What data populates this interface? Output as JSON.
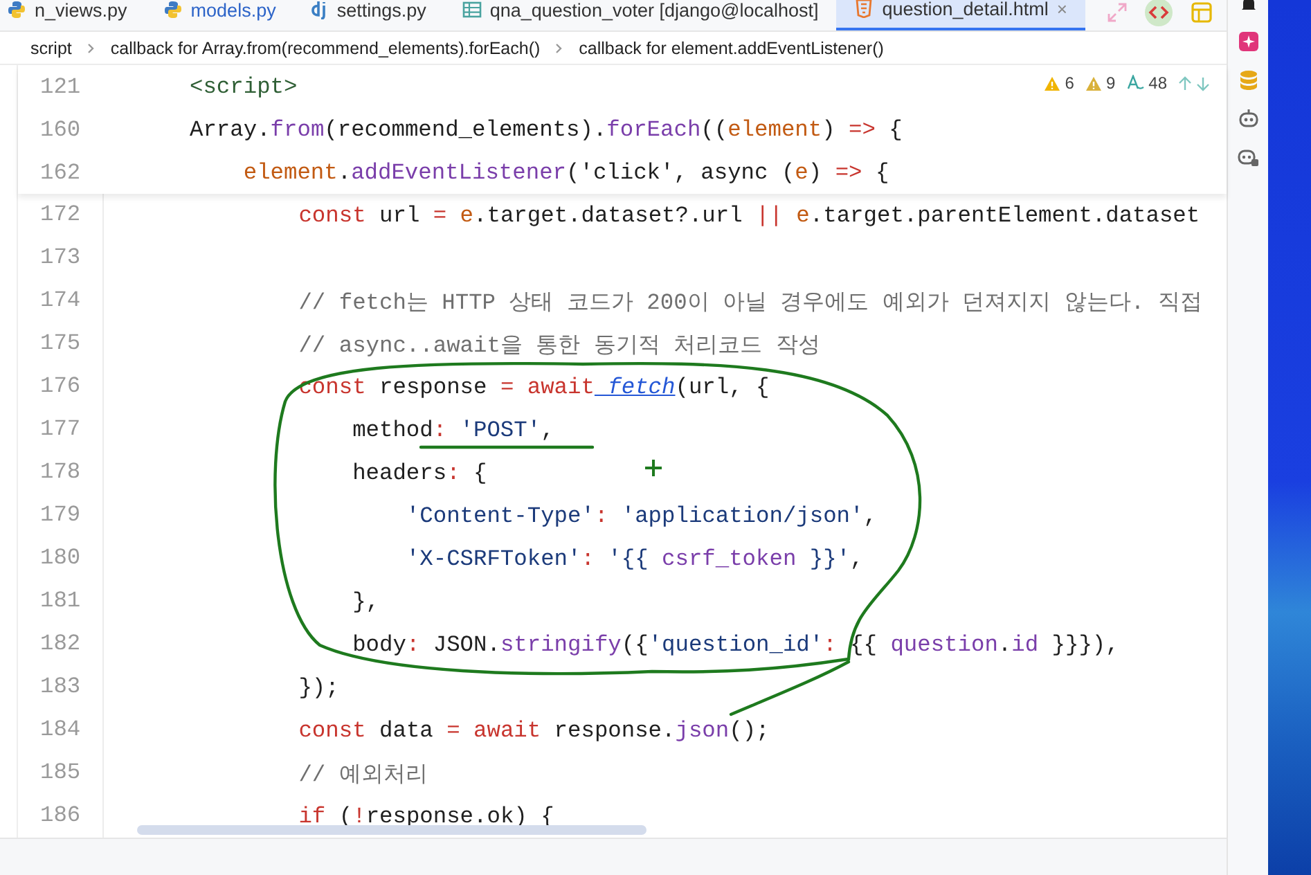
{
  "tabs": [
    {
      "label": "n_views.py",
      "kind": "python",
      "selected": false,
      "modified": false
    },
    {
      "label": "models.py",
      "kind": "python",
      "selected": false,
      "modified": true
    },
    {
      "label": "settings.py",
      "kind": "django",
      "selected": false,
      "modified": false
    },
    {
      "label": "qna_question_voter [django@localhost]",
      "kind": "table",
      "selected": false,
      "modified": false
    },
    {
      "label": "question_detail.html",
      "kind": "html",
      "selected": true,
      "modified": false,
      "close": "×"
    }
  ],
  "breadcrumbs": [
    "script",
    "callback for Array.from(recommend_elements).forEach()",
    "callback for element.addEventListener()"
  ],
  "inspections": {
    "warnings": "6",
    "weak_warnings": "9",
    "typos": "48"
  },
  "sticky_lines": [
    {
      "num": "121",
      "tokens": [
        {
          "text": "<script>",
          "kind": "tag"
        }
      ]
    },
    {
      "num": "160",
      "tokens": [
        {
          "text": "Array.",
          "kind": "plain"
        },
        {
          "text": "from",
          "kind": "fn"
        },
        {
          "text": "(recommend_elements).",
          "kind": "plain"
        },
        {
          "text": "forEach",
          "kind": "fn"
        },
        {
          "text": "((",
          "kind": "plain"
        },
        {
          "text": "element",
          "kind": "param"
        },
        {
          "text": ") ",
          "kind": "plain"
        },
        {
          "text": "=>",
          "kind": "kw"
        },
        {
          "text": " {",
          "kind": "plain"
        }
      ]
    },
    {
      "num": "162",
      "tokens": [
        {
          "text": "    element",
          "kind": "param"
        },
        {
          "text": ".",
          "kind": "plain"
        },
        {
          "text": "addEventListener",
          "kind": "fn"
        },
        {
          "text": "('click', async (",
          "kind": "plain"
        },
        {
          "text": "e",
          "kind": "param"
        },
        {
          "text": ") ",
          "kind": "plain"
        },
        {
          "text": "=>",
          "kind": "kw"
        },
        {
          "text": " {",
          "kind": "plain"
        }
      ]
    }
  ],
  "lines": [
    {
      "num": "172",
      "tokens": [
        {
          "text": "        const",
          "kind": "kw"
        },
        {
          "text": " url ",
          "kind": "plain"
        },
        {
          "text": "=",
          "kind": "kw"
        },
        {
          "text": " e",
          "kind": "param"
        },
        {
          "text": ".target.dataset?.url ",
          "kind": "plain"
        },
        {
          "text": "||",
          "kind": "kw"
        },
        {
          "text": " e",
          "kind": "param"
        },
        {
          "text": ".target.parentElement.dataset",
          "kind": "plain"
        }
      ]
    },
    {
      "num": "173"
    },
    {
      "num": "174",
      "tokens": [
        {
          "text": "        // fetch는 HTTP 상태 코드가 200이 아닐 경우에도 예외가 던져지지 않는다. 직접",
          "kind": "cmt"
        }
      ]
    },
    {
      "num": "175",
      "tokens": [
        {
          "text": "        // async..await을 통한 동기적 처리코드 작성",
          "kind": "cmt"
        }
      ]
    },
    {
      "num": "176",
      "tokens": [
        {
          "text": "        const",
          "kind": "kw"
        },
        {
          "text": " response ",
          "kind": "plain"
        },
        {
          "text": "= await",
          "kind": "kw"
        },
        {
          "text": " fetch",
          "kind": "link"
        },
        {
          "text": "(url, {",
          "kind": "plain"
        }
      ]
    },
    {
      "num": "177",
      "tokens": [
        {
          "text": "            method",
          "kind": "plain"
        },
        {
          "text": ":",
          "kind": "kw"
        },
        {
          "text": " 'POST'",
          "kind": "str"
        },
        {
          "text": ",",
          "kind": "plain"
        }
      ]
    },
    {
      "num": "178",
      "tokens": [
        {
          "text": "            headers",
          "kind": "plain"
        },
        {
          "text": ":",
          "kind": "kw"
        },
        {
          "text": " {",
          "kind": "plain"
        }
      ]
    },
    {
      "num": "179",
      "tokens": [
        {
          "text": "                'Content-Type'",
          "kind": "str"
        },
        {
          "text": ":",
          "kind": "kw"
        },
        {
          "text": " 'application/json'",
          "kind": "str"
        },
        {
          "text": ",",
          "kind": "plain"
        }
      ]
    },
    {
      "num": "180",
      "tokens": [
        {
          "text": "                'X-CSRFToken'",
          "kind": "str"
        },
        {
          "text": ":",
          "kind": "kw"
        },
        {
          "text": " '{{ ",
          "kind": "str"
        },
        {
          "text": "csrf_token",
          "kind": "fn"
        },
        {
          "text": " }}'",
          "kind": "str"
        },
        {
          "text": ",",
          "kind": "plain"
        }
      ]
    },
    {
      "num": "181",
      "tokens": [
        {
          "text": "            },",
          "kind": "plain"
        }
      ]
    },
    {
      "num": "182",
      "tokens": [
        {
          "text": "            body",
          "kind": "plain"
        },
        {
          "text": ":",
          "kind": "kw"
        },
        {
          "text": " JSON.",
          "kind": "plain"
        },
        {
          "text": "stringify",
          "kind": "fn"
        },
        {
          "text": "({",
          "kind": "plain"
        },
        {
          "text": "'question_id'",
          "kind": "str"
        },
        {
          "text": ":",
          "kind": "kw"
        },
        {
          "text": " {{ ",
          "kind": "plain"
        },
        {
          "text": "question",
          "kind": "fn"
        },
        {
          "text": ".",
          "kind": "plain"
        },
        {
          "text": "id",
          "kind": "fn"
        },
        {
          "text": " }}}),",
          "kind": "plain"
        }
      ]
    },
    {
      "num": "183",
      "tokens": [
        {
          "text": "        });",
          "kind": "plain"
        }
      ]
    },
    {
      "num": "184",
      "tokens": [
        {
          "text": "        const",
          "kind": "kw"
        },
        {
          "text": " data ",
          "kind": "plain"
        },
        {
          "text": "= await",
          "kind": "kw"
        },
        {
          "text": " response.",
          "kind": "plain"
        },
        {
          "text": "json",
          "kind": "fn"
        },
        {
          "text": "();",
          "kind": "plain"
        }
      ]
    },
    {
      "num": "185",
      "tokens": [
        {
          "text": "        // 예외처리",
          "kind": "cmt"
        }
      ]
    },
    {
      "num": "186",
      "tokens": [
        {
          "text": "        if",
          "kind": "kw"
        },
        {
          "text": " (",
          "kind": "plain"
        },
        {
          "text": "!",
          "kind": "kw"
        },
        {
          "text": "response.ok) {",
          "kind": "plain"
        }
      ]
    }
  ]
}
